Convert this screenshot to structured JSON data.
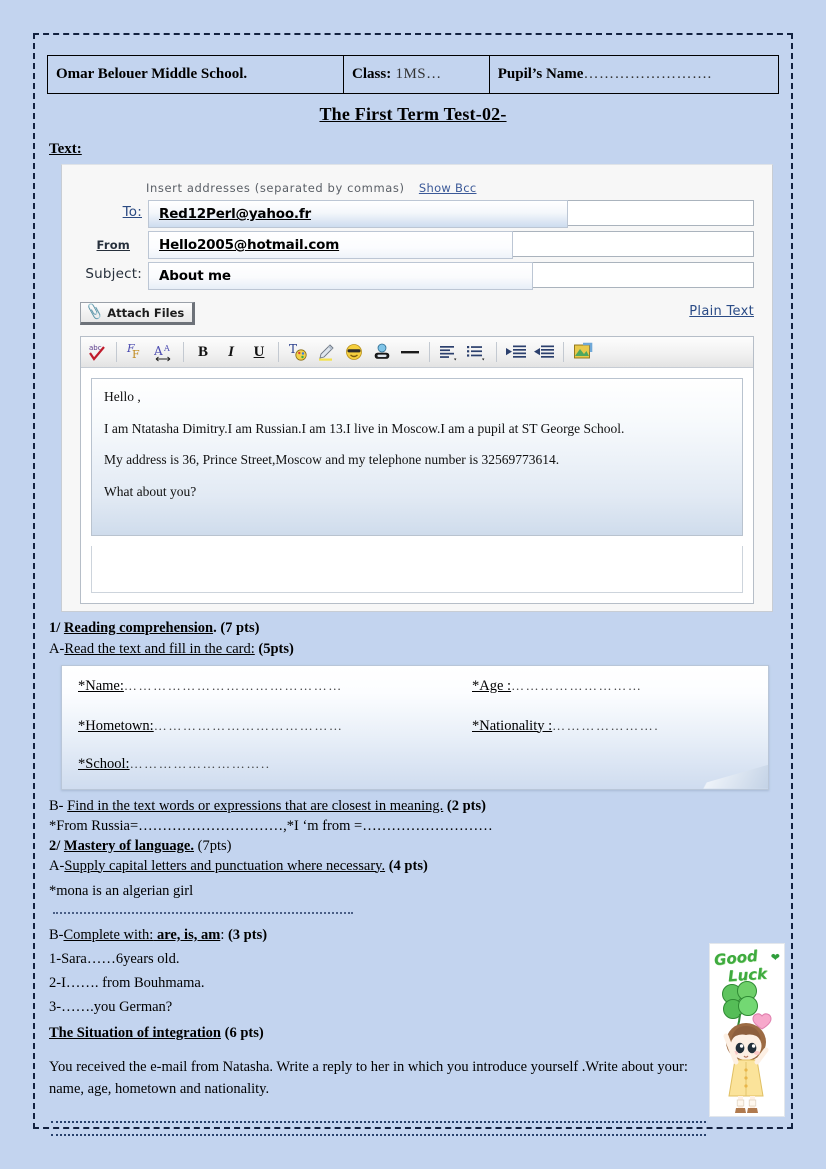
{
  "page": {
    "background_color": "#c3d4ef",
    "title": "The First Term Test-02-"
  },
  "header": {
    "school": "Omar Belouer Middle School.",
    "class_label": "Class:",
    "class_value": " 1MS…",
    "pupil_label": "Pupil’s Name",
    "pupil_dots": "……………………."
  },
  "text_section": {
    "label": "Text:"
  },
  "mail": {
    "insert_hint": "Insert addresses (separated by commas)",
    "show_bcc": "Show Bcc",
    "to_label": "To:",
    "to_value": "Red12Perl@yahoo.fr",
    "from_label": "From",
    "from_value": "Hello2005@hotmail.com",
    "subject_label": "Subject:",
    "subject_value": "About me",
    "attach_label": "Attach Files",
    "plain_text": "Plain Text",
    "toolbar": [
      {
        "name": "spellcheck-icon",
        "glyph": "abc"
      },
      {
        "name": "font-family-icon",
        "glyph": "F"
      },
      {
        "name": "font-size-icon",
        "glyph": "A"
      },
      {
        "name": "bold-icon",
        "glyph": "B"
      },
      {
        "name": "italic-icon",
        "glyph": "I"
      },
      {
        "name": "underline-icon",
        "glyph": "U"
      },
      {
        "name": "text-color-icon",
        "glyph": "T"
      },
      {
        "name": "highlighter-icon",
        "glyph": "/"
      },
      {
        "name": "emoticon-icon",
        "glyph": "☺"
      },
      {
        "name": "insert-link-icon",
        "glyph": "⚭"
      },
      {
        "name": "horizontal-rule-icon",
        "glyph": "—"
      },
      {
        "name": "align-text-icon",
        "glyph": "≡"
      },
      {
        "name": "bulleted-list-icon",
        "glyph": "≣"
      },
      {
        "name": "outdent-icon",
        "glyph": "⇤"
      },
      {
        "name": "indent-icon",
        "glyph": "⇥"
      },
      {
        "name": "insert-image-icon",
        "glyph": "◧"
      }
    ],
    "body": [
      "Hello ,",
      "I  am  Ntatasha  Dimitry.I  am  Russian.I  am  13.I  live  in  Moscow.I  am  a  pupil  at  ST  George School.",
      "My address is 36,  Prince Street,Moscow  and my telephone  number  is 32569773614.",
      "What about you?"
    ]
  },
  "exercises": {
    "q1_number": "1/ ",
    "q1_title": "Reading comprehension",
    "q1_points": ". (7 pts)",
    "q1a_prefix": "A-",
    "q1a_text": "Read the text and fill in the card:",
    "q1a_points": " (5pts)",
    "card": {
      "name_label": "*Name:",
      "name_dots": "………………………………………",
      "age_label": "*Age :",
      "age_dots": "………………………",
      "hometown_label": "*Hometown:",
      "hometown_dots": "…………………………………",
      "nationality_label": "*Nationality :",
      "nationality_dots": "………………….",
      "school_label": "*School:",
      "school_dots": "……………………….."
    },
    "q1b_prefix": "B- ",
    "q1b_text": "Find in the text words or expressions that are closest in meaning.",
    "q1b_points": " (2 pts)",
    "q1b_items": " *From Russia=…………………………,*I ‘m from =………………………",
    "q2_number": "2/ ",
    "q2_title": "Mastery of language.",
    "q2_points": " (7pts)",
    "q2a_prefix": "A-",
    "q2a_text": "Supply capital letters and punctuation where necessary.",
    "q2a_points": " (4 pts)",
    "q2a_item": "*mona is an algerian girl",
    "q2b_prefix": "B-",
    "q2b_text": "Complete with:",
    "q2b_bold": " are, is, am",
    "q2b_colon": ":",
    "q2b_points": " (3 pts)",
    "q2b_items": [
      "1-Sara……6years old.",
      "2-I……. from Bouhmama.",
      "3-…….you German?"
    ],
    "q3_title": "The Situation of integration",
    "q3_points": " (6 pts)",
    "q3_text": "You  received the e-mail from Natasha. Write a reply to her in which you introduce yourself .Write about your: name, age, hometown and nationality."
  },
  "good_luck": {
    "line1": "Good",
    "line2": "Luck",
    "alt": "good-luck-clover-girl"
  }
}
